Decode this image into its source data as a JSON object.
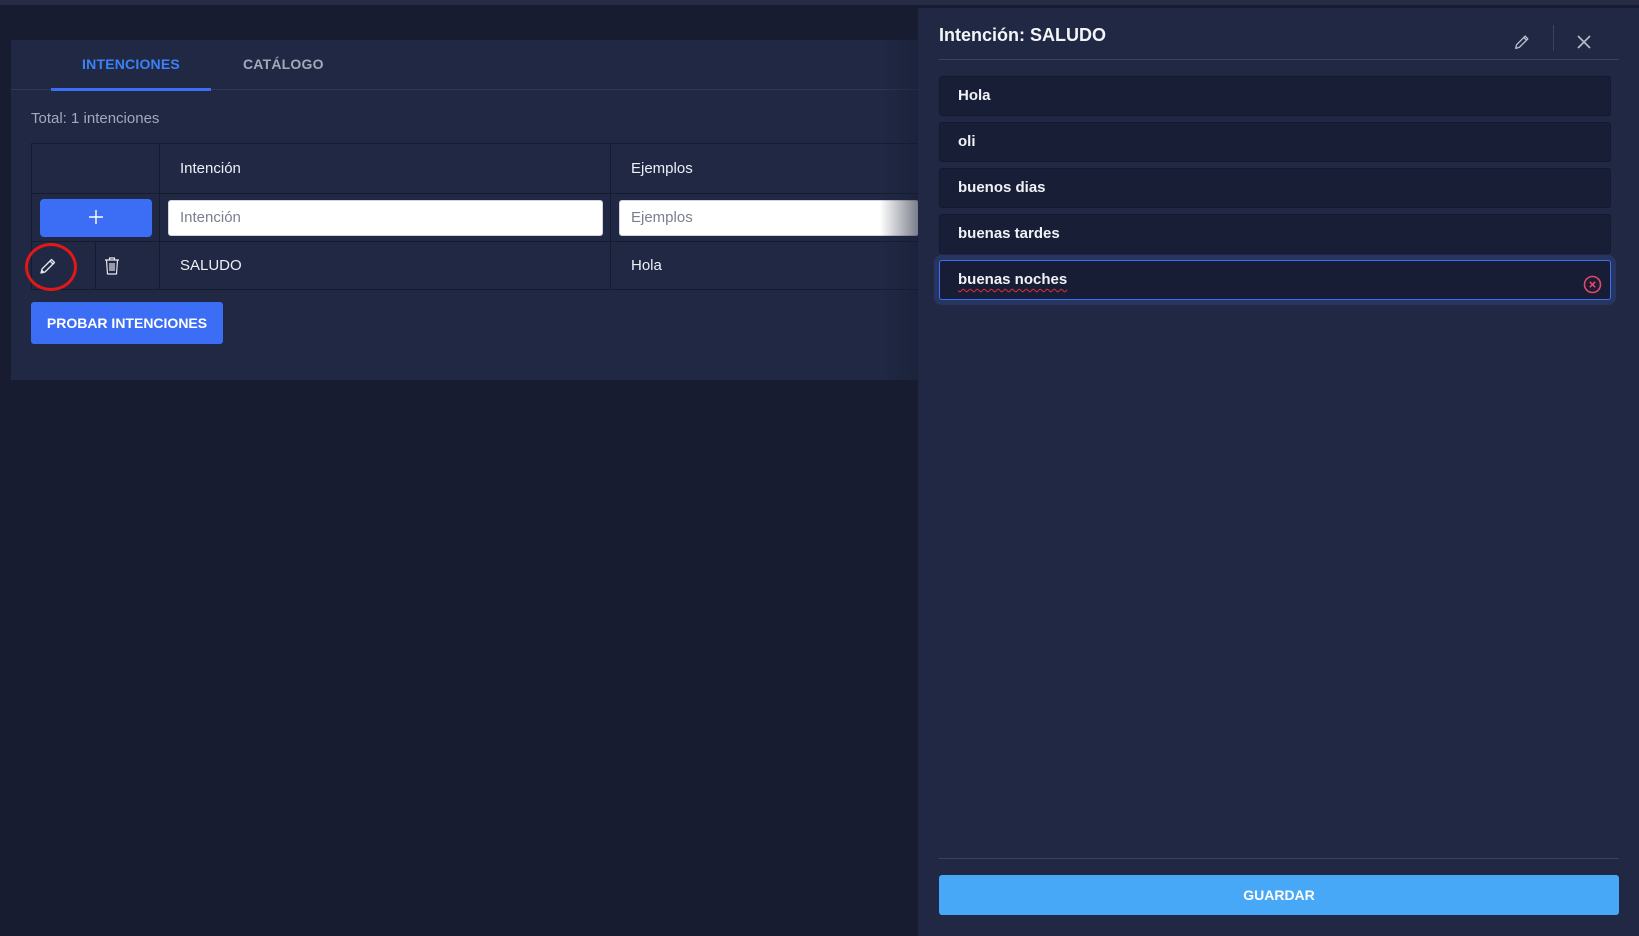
{
  "tabs": [
    {
      "label": "INTENCIONES",
      "active": true
    },
    {
      "label": "CATÁLOGO",
      "active": false
    }
  ],
  "total_text": "Total: 1 intenciones",
  "table": {
    "headers": [
      "",
      "Intención",
      "Ejemplos"
    ],
    "new_row": {
      "intent_placeholder": "Intención",
      "examples_placeholder": "Ejemplos"
    },
    "rows": [
      {
        "intent": "SALUDO",
        "example": "Hola"
      }
    ]
  },
  "test_button_label": "PROBAR INTENCIONES",
  "panel": {
    "title": "Intención: SALUDO",
    "examples": [
      "Hola",
      "oli",
      "buenos dias",
      "buenas tardes",
      "buenas noches"
    ],
    "save_label": "GUARDAR"
  },
  "colors": {
    "accent": "#3b6df5",
    "save": "#46a8f6",
    "annotation": "#e01818"
  }
}
